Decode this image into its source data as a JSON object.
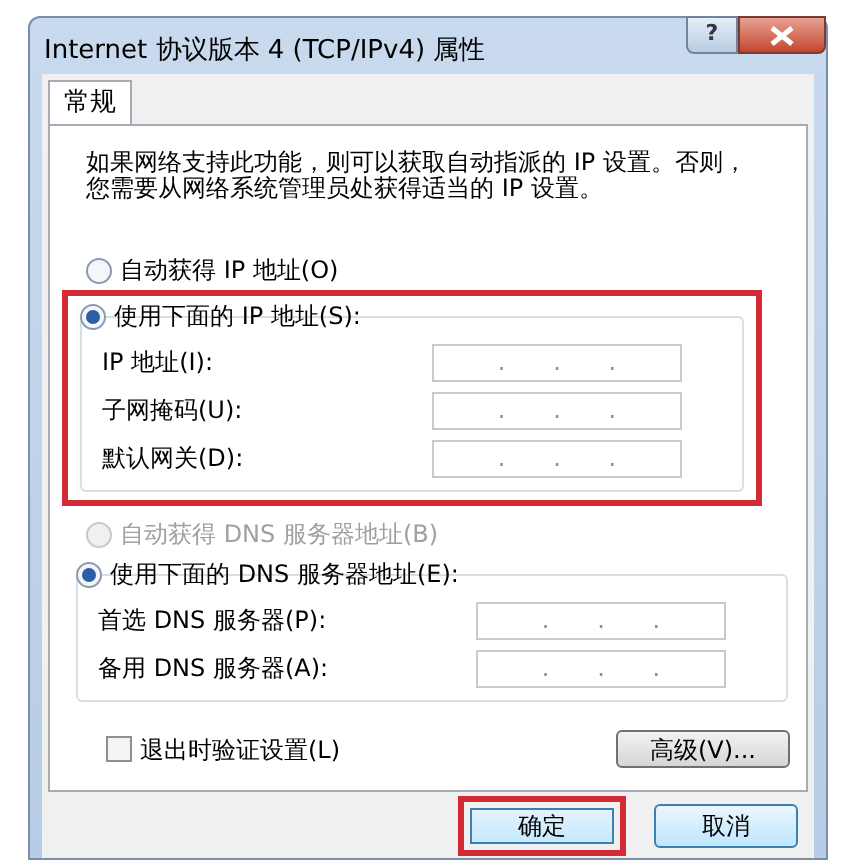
{
  "window": {
    "title": "Internet 协议版本 4 (TCP/IPv4) 属性",
    "help": "?"
  },
  "tabs": [
    {
      "label": "常规",
      "selected": true
    }
  ],
  "description": "如果网络支持此功能，则可以获取自动指派的 IP 设置。否则，您需要从网络系统管理员处获得适当的 IP 设置。",
  "ip_section": {
    "options": [
      {
        "label": "自动获得 IP 地址(O)",
        "selected": false,
        "disabled": false
      },
      {
        "label": "使用下面的 IP 地址(S):",
        "selected": true,
        "disabled": false
      }
    ],
    "highlighted": true,
    "fields": [
      {
        "label": "IP 地址(I):",
        "dots": [
          ".",
          ".",
          "."
        ]
      },
      {
        "label": "子网掩码(U):",
        "dots": [
          ".",
          ".",
          "."
        ]
      },
      {
        "label": "默认网关(D):",
        "dots": [
          ".",
          ".",
          "."
        ]
      }
    ]
  },
  "dns_section": {
    "options": [
      {
        "label": "自动获得 DNS 服务器地址(B)",
        "selected": false,
        "disabled": true
      },
      {
        "label": "使用下面的 DNS 服务器地址(E):",
        "selected": true,
        "disabled": false
      }
    ],
    "highlighted": false,
    "fields": [
      {
        "label": "首选 DNS 服务器(P):",
        "dots": [
          ".",
          ".",
          "."
        ]
      },
      {
        "label": "备用 DNS 服务器(A):",
        "dots": [
          ".",
          ".",
          "."
        ]
      }
    ]
  },
  "validate_checkbox": {
    "label": "退出时验证设置(L)",
    "checked": false
  },
  "advanced_button": "高级(V)...",
  "buttons": [
    {
      "label": "确定",
      "highlighted": true
    },
    {
      "label": "取消",
      "highlighted": false
    }
  ]
}
